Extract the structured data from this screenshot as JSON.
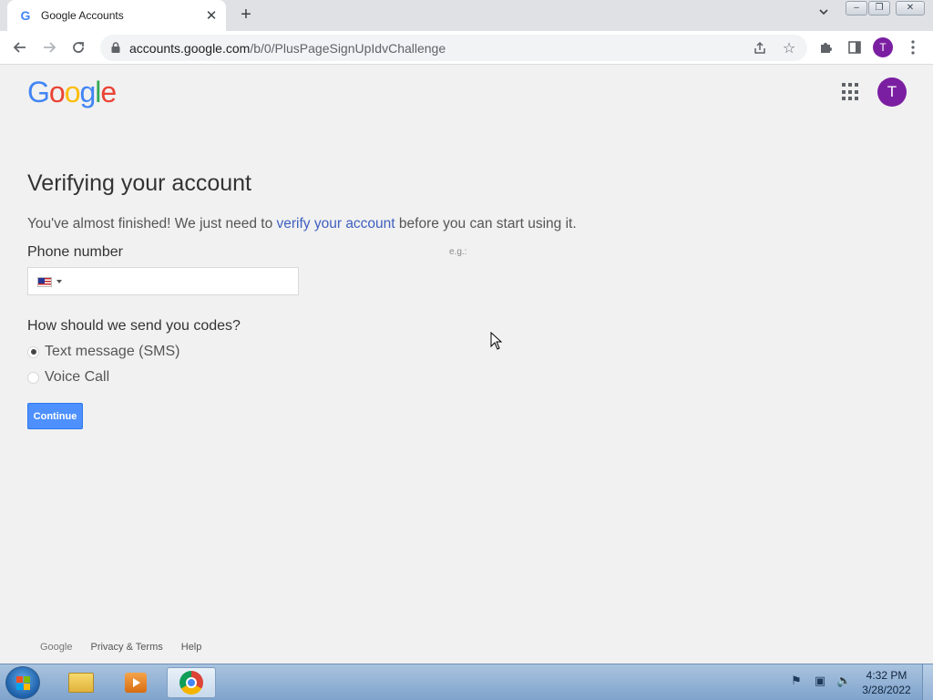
{
  "browser": {
    "tab_title": "Google Accounts",
    "tab_favicon": "G",
    "tab_close": "✕",
    "new_tab": "+",
    "url_host": "accounts.google.com",
    "url_path": "/b/0/PlusPageSignUpIdvChallenge",
    "profile_initial": "T"
  },
  "header": {
    "logo_letters": [
      {
        "ch": "G",
        "color": "#4285F4"
      },
      {
        "ch": "o",
        "color": "#EA4335"
      },
      {
        "ch": "o",
        "color": "#FBBC05"
      },
      {
        "ch": "g",
        "color": "#4285F4"
      },
      {
        "ch": "l",
        "color": "#34A853"
      },
      {
        "ch": "e",
        "color": "#EA4335"
      }
    ],
    "avatar_initial": "T",
    "avatar_color": "#7b1fa2"
  },
  "main": {
    "heading": "Verifying your account",
    "intro_before": "You've almost finished! We just need to ",
    "intro_link": "verify your account",
    "intro_after": " before you can start using it.",
    "phone_label": "Phone number",
    "phone_hint": "e.g.:",
    "phone_value": "",
    "country_flag": "us-flag",
    "codes_label": "How should we send you codes?",
    "options": [
      {
        "label": "Text message (SMS)",
        "checked": true
      },
      {
        "label": "Voice Call",
        "checked": false
      }
    ],
    "continue_label": "Continue",
    "accent_color": "#4d90fe"
  },
  "footer": {
    "brand": "Google",
    "privacy": "Privacy & Terms",
    "help": "Help"
  },
  "taskbar": {
    "time": "4:32 PM",
    "date": "3/28/2022"
  }
}
